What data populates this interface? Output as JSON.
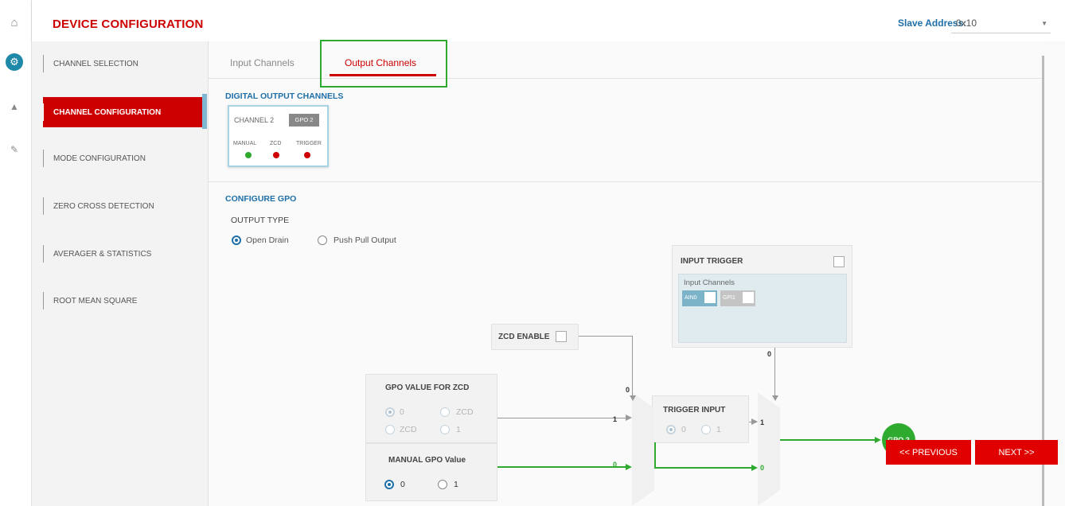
{
  "rail": {
    "icons": [
      "home-icon",
      "gear-icon",
      "chart-icon",
      "pencil-icon"
    ]
  },
  "header": {
    "title": "DEVICE CONFIGURATION",
    "slave_label": "Slave Address:",
    "slave_value": "0x10"
  },
  "sidebar": {
    "items": [
      {
        "label": "CHANNEL SELECTION"
      },
      {
        "label": "CHANNEL CONFIGURATION"
      },
      {
        "label": "MODE CONFIGURATION"
      },
      {
        "label": "ZERO CROSS DETECTION"
      },
      {
        "label": "AVERAGER & STATISTICS"
      },
      {
        "label": "ROOT MEAN SQUARE"
      }
    ],
    "active_index": 1
  },
  "tabs": [
    {
      "label": "Input Channels"
    },
    {
      "label": "Output Channels"
    }
  ],
  "digital_output": {
    "title": "DIGITAL OUTPUT CHANNELS",
    "card": {
      "channel": "CHANNEL 2",
      "badge": "GPO 2",
      "labels": [
        "MANUAL",
        "ZCD",
        "TRIGGER"
      ],
      "colors": [
        "#2eaa2e",
        "#cc0000",
        "#cc0000"
      ]
    }
  },
  "configure": {
    "title": "CONFIGURE GPO",
    "output_type_label": "OUTPUT TYPE",
    "options": [
      "Open Drain",
      "Push Pull Output"
    ],
    "selected": "Open Drain"
  },
  "input_trigger": {
    "title": "INPUT TRIGGER",
    "sub_label": "Input Channels",
    "channels": [
      "AIN0",
      "GPI1"
    ]
  },
  "zcd_enable": {
    "label": "ZCD ENABLE"
  },
  "gpo_zcd": {
    "title": "GPO VALUE FOR ZCD",
    "options": [
      "0",
      "ZCD",
      "ZCD",
      "1"
    ]
  },
  "manual_gpo": {
    "title": "MANUAL GPO Value",
    "options": [
      "0",
      "1"
    ],
    "selected": "0"
  },
  "trigger_input": {
    "title": "TRIGGER INPUT",
    "options": [
      "0",
      "1"
    ]
  },
  "diagram_bits": {
    "zcd_sel": "0",
    "trig_sel": "0",
    "mux1_in1": "1",
    "mux1_in0": "0",
    "mux2_in1": "1",
    "mux2_in0": "0"
  },
  "output": {
    "label": "GPO 2"
  },
  "nav_buttons": {
    "previous": "<< PREVIOUS",
    "next": "NEXT >>"
  }
}
